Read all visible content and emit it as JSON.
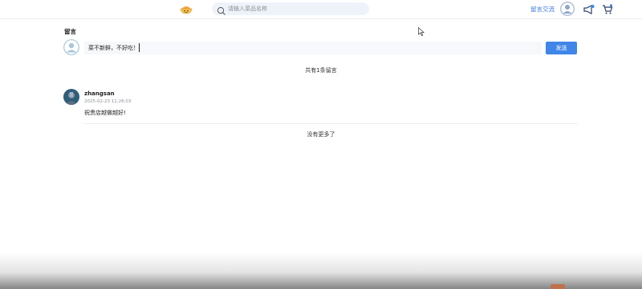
{
  "header": {
    "search_placeholder": "请输入菜品名称",
    "nav_link": "留言交流",
    "logo_icon": "bowl-logo-icon",
    "search_icon": "search-icon",
    "avatar_icon": "user-avatar-icon",
    "notify_icon": "megaphone-icon",
    "cart_icon": "cart-icon"
  },
  "composer": {
    "section_title": "留言",
    "input_value": "菜不新鲜，不好吃！",
    "send_label": "发送"
  },
  "summary": {
    "count_text": "共有1条留言"
  },
  "comments": [
    {
      "username": "zhangsan",
      "timestamp": "2025-02-23 11:26:03",
      "text": "祝贵店越做越好!"
    }
  ],
  "footer": {
    "no_more_text": "没有更多了"
  },
  "colors": {
    "accent": "#3f86e8",
    "link": "#3a7be0",
    "search_bg": "#eef3fa"
  }
}
